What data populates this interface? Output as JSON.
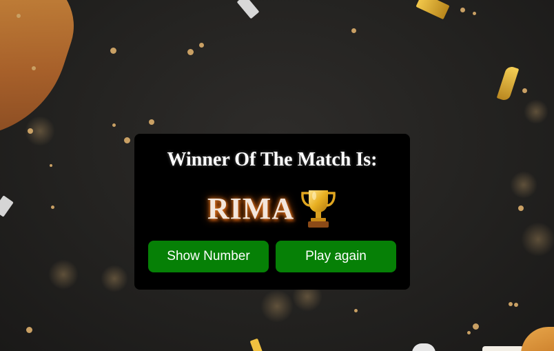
{
  "heading": "Winner Of The Match Is:",
  "winner": {
    "name": "RIMA",
    "icon": "trophy-icon"
  },
  "buttons": {
    "show_number": "Show Number",
    "play_again": "Play again"
  },
  "colors": {
    "card_background": "#000000",
    "button_green": "#068006",
    "name_glow": "#e07a1f",
    "trophy_gold": "#e8b022"
  }
}
